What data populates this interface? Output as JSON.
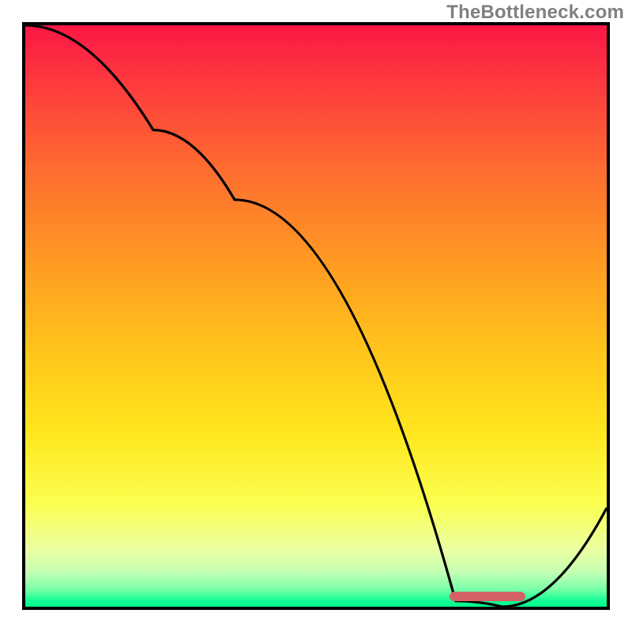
{
  "attribution": "TheBottleneck.com",
  "chart_data": {
    "type": "line",
    "title": "",
    "xlabel": "",
    "ylabel": "",
    "x": [
      0,
      22,
      36,
      74,
      82,
      100
    ],
    "values": [
      100,
      82,
      70,
      1,
      0,
      17
    ],
    "xlim": [
      0,
      100
    ],
    "ylim": [
      0,
      100
    ],
    "optimum_marker": {
      "x_start": 73,
      "x_end": 86,
      "y": 0.9
    },
    "gradient_stops": [
      {
        "pos": 0,
        "color": "#fc1745"
      },
      {
        "pos": 10,
        "color": "#fd3a3e"
      },
      {
        "pos": 25,
        "color": "#fe6d2f"
      },
      {
        "pos": 40,
        "color": "#ff9823"
      },
      {
        "pos": 55,
        "color": "#ffc21c"
      },
      {
        "pos": 70,
        "color": "#ffe61d"
      },
      {
        "pos": 82,
        "color": "#fbff4e"
      },
      {
        "pos": 90,
        "color": "#ecffa0"
      },
      {
        "pos": 94,
        "color": "#c5ffb3"
      },
      {
        "pos": 97,
        "color": "#79ffa8"
      },
      {
        "pos": 99,
        "color": "#12fe94"
      },
      {
        "pos": 100,
        "color": "#00fa8e"
      }
    ]
  }
}
